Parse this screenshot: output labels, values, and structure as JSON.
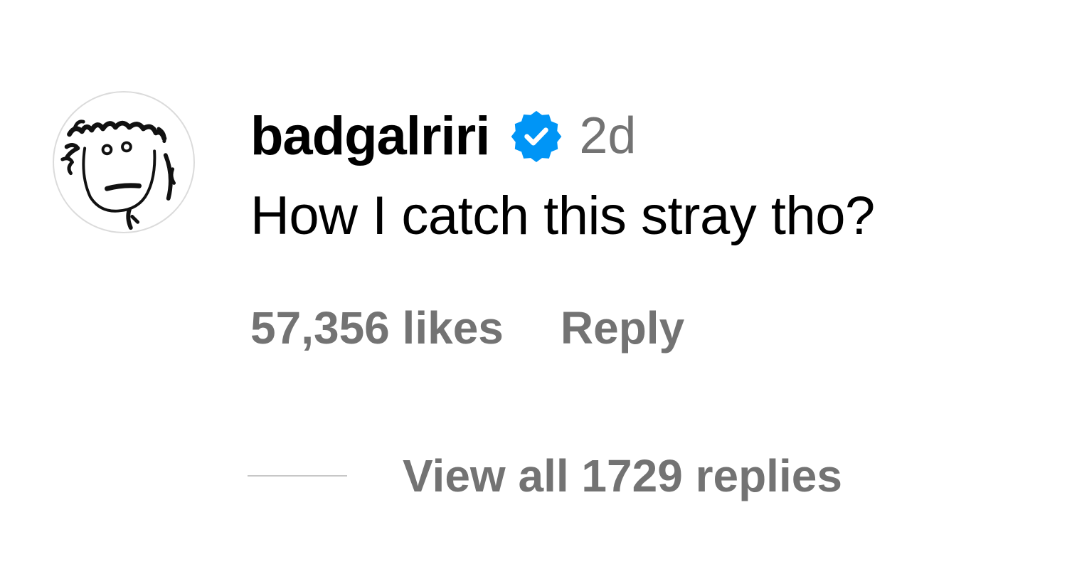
{
  "comment": {
    "username": "badgalriri",
    "verified_icon": "verified-badge-icon",
    "timestamp": "2d",
    "text": "How I catch this stray tho?",
    "likes": "57,356 likes",
    "reply_label": "Reply",
    "view_replies_label": "View all 1729 replies"
  },
  "colors": {
    "verified_blue": "#0095f6",
    "secondary_text": "#737373",
    "primary_text": "#000000"
  }
}
